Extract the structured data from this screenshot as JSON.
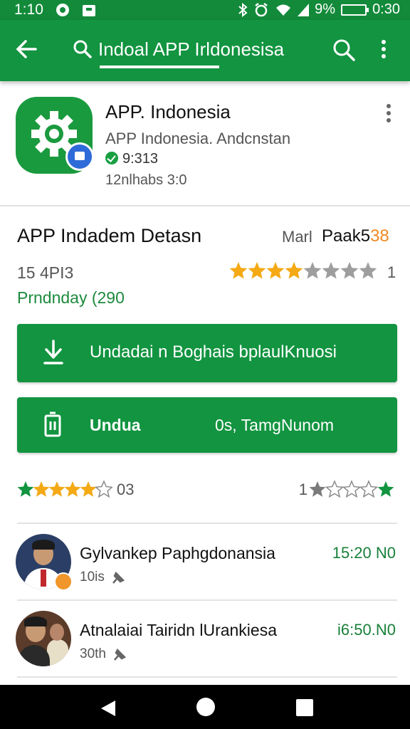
{
  "status_bar": {
    "time": "1:10",
    "battery": "9%",
    "clock_right": "0:30"
  },
  "toolbar": {
    "search_text": "Indoal APP Irldonesisa"
  },
  "app": {
    "name": "APP. Indonesia",
    "developer": "APP Indonesia. Andcnstan",
    "version": "9:313",
    "installs": "12nlhabs 3:0"
  },
  "details": {
    "title": "APP Indadem Detasn",
    "mark_label": "Marl",
    "mark_value_main": "Paak5",
    "mark_value_accent": "38",
    "size": "15 4PI3",
    "date": "Prndnday (290",
    "rating": 4,
    "rating_max": 8,
    "rating_count": "1"
  },
  "buttons": {
    "download": "Undadai n Boghais bplaulKnuosi",
    "install_label": "Undua",
    "install_extra": "0s, TamgNunom"
  },
  "ratings_row": {
    "left_count": "03",
    "right_count": "1"
  },
  "reviews": [
    {
      "name": "Gylvankep Paphgdonansia",
      "time": "15:20 N0",
      "sub": "10is"
    },
    {
      "name": "Atnalaiai Tairidn lUrankiesa",
      "time": "i6:50.N0",
      "sub": "30th"
    }
  ],
  "colors": {
    "primary_green": "#129440",
    "status_green": "#128a3a",
    "star_gold": "#f4a915",
    "star_grey": "#9e9e9e",
    "accent_orange": "#f08a24"
  }
}
